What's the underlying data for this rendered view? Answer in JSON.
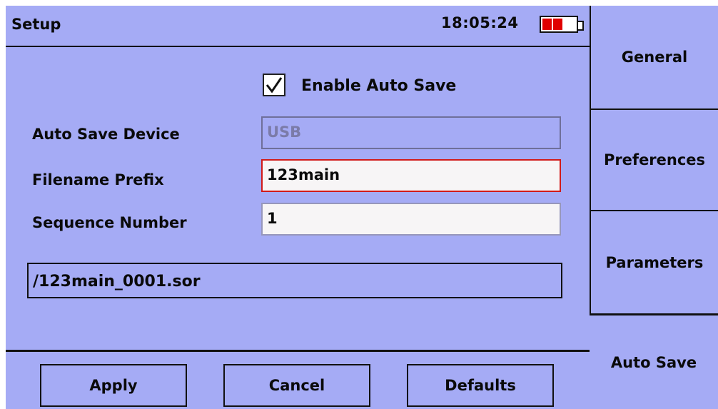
{
  "header": {
    "title": "Setup",
    "time": "18:05:24",
    "battery_icon": "battery-icon"
  },
  "auto_save": {
    "enable_label": "Enable Auto Save",
    "enabled": true
  },
  "fields": {
    "device_label": "Auto Save Device",
    "device_value": "USB",
    "prefix_label": "Filename Prefix",
    "prefix_value": "123main",
    "sequence_label": "Sequence Number",
    "sequence_value": "1"
  },
  "file_path": "/123main_0001.sor",
  "buttons": {
    "apply": "Apply",
    "cancel": "Cancel",
    "defaults": "Defaults"
  },
  "tabs": [
    {
      "label": "General"
    },
    {
      "label": "Preferences"
    },
    {
      "label": "Parameters"
    },
    {
      "label": "Auto Save",
      "selected": true
    }
  ],
  "colors": {
    "panel": "#a5abf5",
    "focus_border": "#d11a1a",
    "battery_level": "#e00000"
  }
}
